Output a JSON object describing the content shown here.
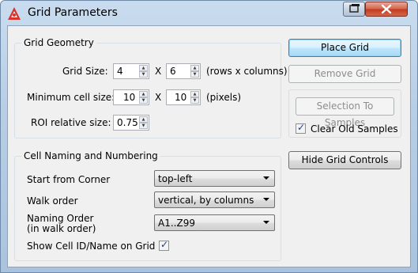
{
  "window": {
    "title": "Grid Parameters",
    "app_icon": "app-logo-icon",
    "restore_icon": "restore-window-icon",
    "close_icon": "close-icon"
  },
  "grid_geometry": {
    "title": "Grid Geometry",
    "grid_size_label": "Grid Size:",
    "rows": "4",
    "cols": "6",
    "x_sep": "X",
    "size_unit": "(rows x columns)",
    "min_cell_label": "Minimum cell size:",
    "min_w": "10",
    "min_h": "10",
    "min_unit": "(pixels)",
    "roi_label": "ROI relative size:",
    "roi": "0.75"
  },
  "naming": {
    "title": "Cell Naming and Numbering",
    "start_label": "Start from Corner",
    "start_value": "top-left",
    "walk_label": "Walk order",
    "walk_value": "vertical, by columns",
    "naming_label_1": "Naming Order",
    "naming_label_2": "(in walk order)",
    "naming_value": "A1..Z99",
    "show_label": "Show Cell ID/Name on Grid",
    "show_checked": true
  },
  "actions": {
    "place": "Place Grid",
    "remove": "Remove Grid",
    "selection": "Selection To Samples",
    "clear_label": "Clear Old Samples",
    "clear_checked": true,
    "hide": "Hide Grid Controls"
  }
}
